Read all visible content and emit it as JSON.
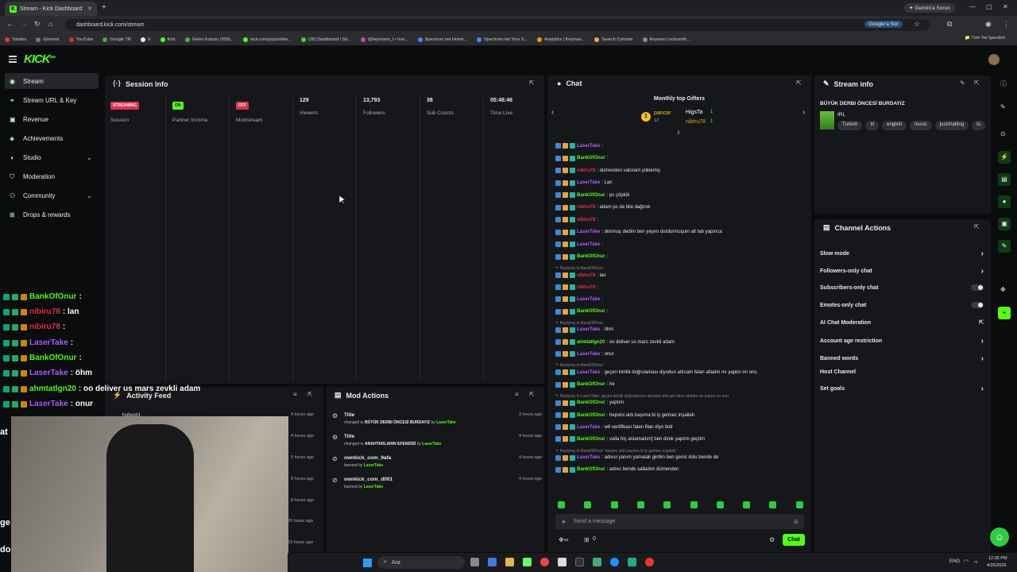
{
  "browser": {
    "tab_title": "Stream - Kick Dashboard",
    "tab_close": "✕",
    "new_tab": "+",
    "gemini": "Gemini'a Sorun",
    "url": "dashboard.kick.com/stream",
    "google_ask": "Google'a Sor",
    "bookmarks": [
      "Yandex",
      "Glovertz",
      "YouTube",
      "Google TR",
      "X",
      "Kick",
      "Gelen Kutusu (939)...",
      "kick.com/popout/ke...",
      "(28) Dashboard / Str...",
      "@keymann_l • Inst...",
      "Spectrum.net Home...",
      "Spectrum.net Your S...",
      "Analytics | Keyman...",
      "Search Console",
      "Keyman Locksmith..."
    ],
    "bookmarks_right": "Tüm Yer İşaretleri",
    "colors": {
      "kick_green": "#53fc18"
    }
  },
  "app": {
    "logo": "KICK",
    "logo_sup": "BETA"
  },
  "sidebar": {
    "items": [
      {
        "label": "Stream",
        "icon": "broadcast-icon"
      },
      {
        "label": "Stream URL & Key",
        "icon": "link-icon"
      },
      {
        "label": "Revenue",
        "icon": "money-icon"
      },
      {
        "label": "Achievements",
        "icon": "trophy-icon"
      },
      {
        "label": "Studio",
        "icon": "studio-icon"
      },
      {
        "label": "Moderation",
        "icon": "shield-icon"
      },
      {
        "label": "Community",
        "icon": "people-icon"
      },
      {
        "label": "Drops & rewards",
        "icon": "gift-icon"
      }
    ]
  },
  "session": {
    "title": "Session Info",
    "stats": [
      {
        "badge": "STREAMING",
        "label": "Session"
      },
      {
        "badge": "ON",
        "label": "Partner Income"
      },
      {
        "badge": "OFF",
        "label": "Multistream"
      },
      {
        "value": "129",
        "label": "Viewers"
      },
      {
        "value": "13,793",
        "label": "Followers"
      },
      {
        "value": "38",
        "label": "Sub Counts"
      },
      {
        "value": "05:48:46",
        "label": "Time Live"
      }
    ]
  },
  "overlay_chat": [
    {
      "user": "BankOfOnur",
      "text": ":",
      "color": "#53fc18"
    },
    {
      "user": "nibiru78",
      "text": ": lan",
      "color": "#e0324b"
    },
    {
      "user": "nibiru78",
      "text": ":",
      "color": "#e0324b"
    },
    {
      "user": "LaserTake",
      "text": ":",
      "color": "#b35cff"
    },
    {
      "user": "BankOfOnur",
      "text": ":",
      "color": "#53fc18"
    },
    {
      "user": "LaserTake",
      "text": ": öhm",
      "color": "#b35cff"
    },
    {
      "user": "ahmtatlgn20",
      "text": ": oo deliver us mars zevkli adam",
      "color": "#53fc18"
    },
    {
      "user": "LaserTake",
      "text": ": onur",
      "color": "#b35cff"
    }
  ],
  "overlay_fragments": [
    "at",
    "ge",
    "do"
  ],
  "activity": {
    "title": "Activity Feed",
    "row_user": "hobost1",
    "times": [
      "4 hours ago",
      "4 hours ago",
      "5 hours ago",
      "8 hours ago",
      "8 hours ago",
      "20 hours ago",
      "23 hours ago"
    ]
  },
  "mod_actions": {
    "title": "Mod Actions",
    "items": [
      {
        "title": "Title",
        "sub_pre": "changed to ",
        "sub_val": "BÜYÜK DERBI ÖNCESİ BURDAYIZ",
        "by": " by ",
        "user": "LaserTake",
        "time": "3 hours ago"
      },
      {
        "title": "Title",
        "sub_pre": "changed to ",
        "sub_val": "ANAHTARLARIN EFENDİSİ",
        "by": " by ",
        "user": "LaserTake",
        "time": "4 hours ago"
      },
      {
        "title": "ownkick_com_9afa",
        "sub_pre": "banned by ",
        "sub_val": "",
        "by": "",
        "user": "LaserTake",
        "time": "4 hours ago"
      },
      {
        "title": "ownkick_com_d001",
        "sub_pre": "banned by ",
        "sub_val": "",
        "by": "",
        "user": "LaserTake",
        "time": "4 hours ago"
      }
    ]
  },
  "chat": {
    "title": "Chat",
    "gifters_title": "Monthly top Gifters",
    "gifters": [
      {
        "name": "pancar",
        "count": "12"
      },
      {
        "name": "HigsTa",
        "count": "1"
      },
      {
        "name": "nibiru78",
        "count": "1"
      }
    ],
    "messages": [
      {
        "user": "LaserTake",
        "text": ":",
        "color": "#b35cff"
      },
      {
        "user": "BankOfOnur",
        "text": ":",
        "color": "#53fc18"
      },
      {
        "user": "nibiru78",
        "text": ": dümenden valorant yüklemiş",
        "color": "#e0324b"
      },
      {
        "user": "LaserTake",
        "text": ": Lan",
        "color": "#b35cff"
      },
      {
        "user": "BankOfOnur",
        "text": ": pc çöplük",
        "color": "#53fc18"
      },
      {
        "user": "nibiru78",
        "text": ": adam pc de bile dağınık",
        "color": "#e0324b"
      },
      {
        "user": "nibiru78",
        "text": ":",
        "color": "#e0324b"
      },
      {
        "user": "LaserTake",
        "text": ": donmuş dedim ben yayını durdurmuşum alt tab yapınca",
        "color": "#b35cff"
      },
      {
        "user": "LaserTake",
        "text": ":",
        "color": "#b35cff"
      },
      {
        "user": "BankOfOnur",
        "text": ":",
        "color": "#53fc18"
      },
      {
        "reply": "Replying to BankOfOnur:"
      },
      {
        "user": "nibiru78",
        "text": ": lan",
        "color": "#e0324b"
      },
      {
        "user": "nibiru78",
        "text": ":",
        "color": "#e0324b"
      },
      {
        "user": "LaserTake",
        "text": ":",
        "color": "#b35cff"
      },
      {
        "user": "BankOfOnur",
        "text": ":",
        "color": "#53fc18"
      },
      {
        "reply": "Replying to BankOfOnur:"
      },
      {
        "user": "LaserTake",
        "text": ": öhm",
        "color": "#b35cff"
      },
      {
        "user": "ahmtatlgn20",
        "text": ": oo deliver us mars zevkli adam",
        "color": "#53fc18"
      },
      {
        "user": "LaserTake",
        "text": ": onur",
        "color": "#b35cff"
      },
      {
        "reply": "Replying to BankOfOnur:"
      },
      {
        "user": "LaserTake",
        "text": ": geçen kimlik doğrulaması diyodun atlıcam falan atladın mı yaptın mı onu",
        "color": "#b35cff"
      },
      {
        "user": "BankOfOnur",
        "text": ": he",
        "color": "#53fc18"
      },
      {
        "reply": "Replying to LaserTake: geçen kimlik doğrulaması diyodun atlıcam falan atladın mı yaptın mı onu"
      },
      {
        "user": "BankOfOnur",
        "text": ": yaptım",
        "color": "#53fc18"
      },
      {
        "user": "BankOfOnur",
        "text": ": hepsini aldı başıma bi iş gelmez inşallah",
        "color": "#53fc18"
      },
      {
        "user": "LaserTake",
        "text": ": w8 sertifikası falan filan diyo bidr",
        "color": "#b35cff"
      },
      {
        "user": "BankOfOnur",
        "text": ": valla hiç anlamadım] ben direk yaptım geçtim",
        "color": "#53fc18"
      },
      {
        "reply": "Replying to BankOfOnur: hepsini aldı başıma bi iş gelmez inşallah"
      },
      {
        "user": "LaserTake",
        "text": ": adresi yanım yamalak girdim ben gerisi dolu bende de",
        "color": "#b35cff"
      },
      {
        "user": "BankOfOnur",
        "text": ": adres bende salladım dümenden",
        "color": "#53fc18"
      }
    ],
    "input_placeholder": "Send a message",
    "send_label": "Chat",
    "viewer_count": "0"
  },
  "stream_info": {
    "title": "Stream info",
    "stream_title": "BÜYÜK DERBI ÖNCESİ BURDAYIZ",
    "category": "IRL",
    "tags": [
      "Turkish",
      "irl",
      "english",
      "music",
      "justchatting",
      "tu"
    ]
  },
  "channel_actions": {
    "title": "Channel Actions",
    "items": [
      {
        "label": "Slow mode",
        "ctrl": "chevron"
      },
      {
        "label": "Followers-only chat",
        "ctrl": "chevron"
      },
      {
        "label": "Subscribers-only chat",
        "ctrl": "toggle"
      },
      {
        "label": "Emotes-only chat",
        "ctrl": "toggle"
      },
      {
        "label": "AI Chat Moderation",
        "ctrl": "external"
      },
      {
        "label": "Account age restriction",
        "ctrl": "chevron"
      },
      {
        "label": "Banned words",
        "ctrl": "chevron"
      },
      {
        "label": "Host Channel",
        "ctrl": "none"
      },
      {
        "label": "Set goals",
        "ctrl": "chevron"
      }
    ]
  },
  "taskbar": {
    "search": "Ara",
    "lang": "ENG",
    "time": "12:36 PM",
    "date": "4/26/2026"
  }
}
